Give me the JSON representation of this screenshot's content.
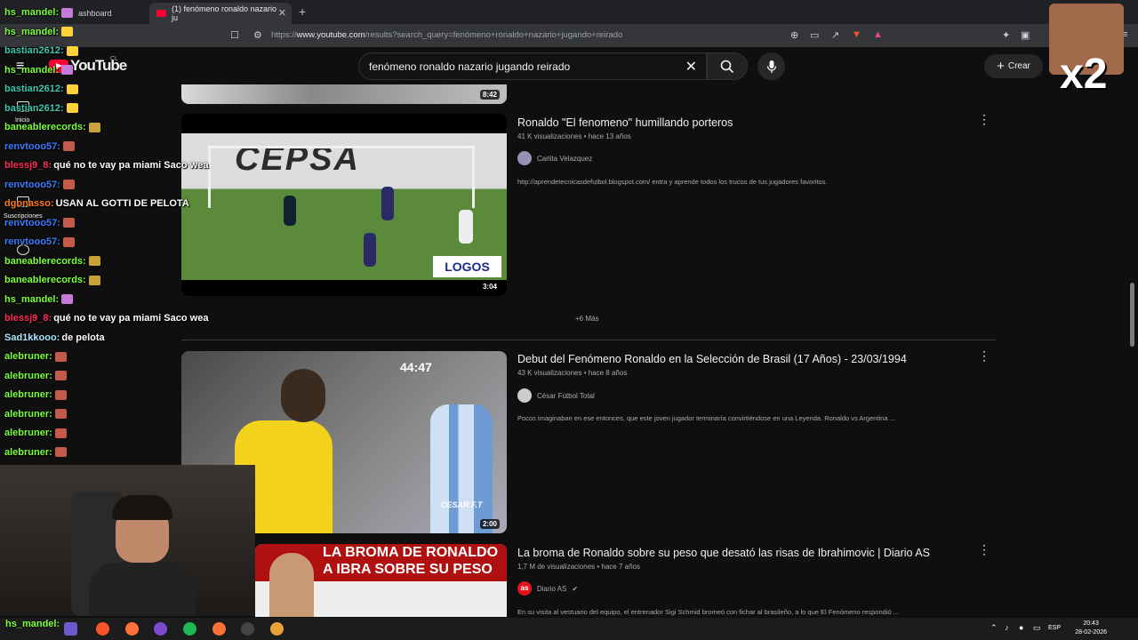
{
  "browser": {
    "tab_inactive_label": "ashboard",
    "tab_active_label": "(1) fenómeno ronaldo nazario ju",
    "url_prefix": "https://",
    "url_domain": "www.youtube.com",
    "url_path": "/results?search_query=fenómeno+ronaldo+nazario+jugando+reirado"
  },
  "youtube": {
    "logo_text": "YouTube",
    "country_code": "CL",
    "search_query": "fenómeno ronaldo nazario jugando reirado",
    "create_label": "Crear",
    "nav": {
      "home": "Inicio",
      "subs": "Suscripciones"
    }
  },
  "results": [
    {
      "duration": "8:42"
    },
    {
      "title": "Ronaldo \"El fenomeno\" humillando porteros",
      "meta": "41 K visualizaciones • hace 13 años",
      "channel": "Carlita Velazquez",
      "description": "http://aprendetecnicasdefutbol.blogspot.com/ entra y aprende todos los trucos de tus jugadores favoritos.",
      "duration": "3:04",
      "thumb_text": "CEPSA",
      "thumb_logo": "LOGOS"
    },
    {
      "title": "Debut del Fenómeno Ronaldo en la Selección de Brasil (17 Años) - 23/03/1994",
      "meta": "43 K visualizaciones • hace 8 años",
      "channel": "César Fútbol Total",
      "description": "Pocos imaginaban en ese entonces, que este joven jugador terminaría convirtiéndose en una Leyenda. Ronaldo vs Argentina ...",
      "duration": "2:00",
      "thumb_clock": "44:47",
      "thumb_watermark": "CESAR F.T"
    },
    {
      "title": "La broma de Ronaldo sobre su peso que desató las risas de Ibrahimovic | Diario AS",
      "meta": "1,7 M de visualizaciones • hace 7 años",
      "channel": "Diario AS",
      "channel_avatar_text": "as",
      "description": "En su visita al vestuario del equipo, el entrenador Sigi Schmid bromeó con fichar al brasileño, a lo que El Fenómeno respondió ...",
      "thumb_line1": "LA BROMA DE RONALDO",
      "thumb_line2": "A IBRA SOBRE SU PESO"
    }
  ],
  "more_label": "+6 Más",
  "chat": [
    {
      "user": "hs_mandel:",
      "msg": "",
      "color": "#7CFF3C"
    },
    {
      "user": "hs_mandel:",
      "msg": "",
      "color": "#7CFF3C"
    },
    {
      "user": "bastian2612:",
      "msg": "",
      "color": "#3CC7B0"
    },
    {
      "user": "hs_mandel:",
      "msg": "",
      "color": "#7CFF3C"
    },
    {
      "user": "bastian2612:",
      "msg": "",
      "color": "#3CC7B0"
    },
    {
      "user": "bastian2612:",
      "msg": "",
      "color": "#3CC7B0"
    },
    {
      "user": "baneablerecords:",
      "msg": "",
      "color": "#7CFF3C"
    },
    {
      "user": "renvtooo57:",
      "msg": "",
      "color": "#3C7CFF"
    },
    {
      "user": "blessj9_8:",
      "msg": "qué no te vay pa miami Saco wea",
      "color": "#FF2D55"
    },
    {
      "user": "renvtooo57:",
      "msg": "",
      "color": "#3C7CFF"
    },
    {
      "user": "dgonasso:",
      "msg": "USAN AL GOTTI DE PELOTA",
      "color": "#FF7A1A"
    },
    {
      "user": "renvtooo57:",
      "msg": "",
      "color": "#3C7CFF"
    },
    {
      "user": "renvtooo57:",
      "msg": "",
      "color": "#3C7CFF"
    },
    {
      "user": "baneablerecords:",
      "msg": "",
      "color": "#7CFF3C"
    },
    {
      "user": "baneablerecords:",
      "msg": "",
      "color": "#7CFF3C"
    },
    {
      "user": "hs_mandel:",
      "msg": "",
      "color": "#7CFF3C"
    },
    {
      "user": "blessj9_8:",
      "msg": "qué no te vay pa miami Saco wea",
      "color": "#FF2D55"
    },
    {
      "user": "Sad1kkooo:",
      "msg": "de pelota",
      "color": "#A9E6FF"
    },
    {
      "user": "alebruner:",
      "msg": "",
      "color": "#7CFF3C"
    },
    {
      "user": "alebruner:",
      "msg": "",
      "color": "#7CFF3C"
    },
    {
      "user": "alebruner:",
      "msg": "",
      "color": "#7CFF3C"
    },
    {
      "user": "alebruner:",
      "msg": "",
      "color": "#7CFF3C"
    },
    {
      "user": "alebruner:",
      "msg": "",
      "color": "#7CFF3C"
    },
    {
      "user": "alebruner:",
      "msg": "",
      "color": "#7CFF3C"
    }
  ],
  "overlay": {
    "x2_text": "x2"
  },
  "taskbar": {
    "bottom_chat_user": "hs_mandel:",
    "lang": "ESP",
    "time": "20:43",
    "date": "28-02-2026"
  },
  "colors": {
    "yt_red": "#ff0033",
    "bg": "#0f0f0f"
  }
}
